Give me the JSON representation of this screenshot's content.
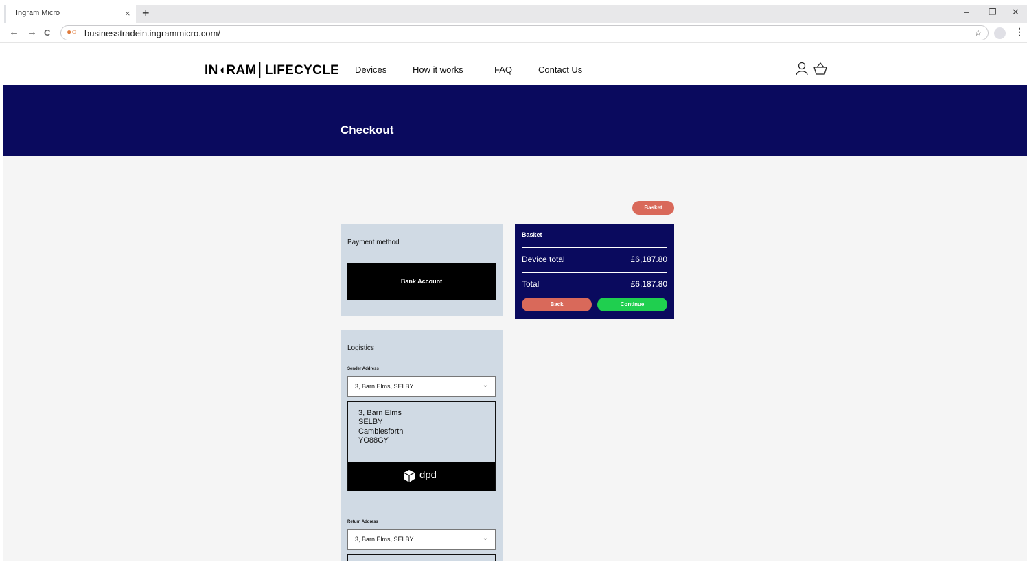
{
  "browser": {
    "tab_title": "Ingram Micro",
    "tab_close": "×",
    "new_tab": "+",
    "url": "businesstradein.ingrammicro.com/",
    "window_controls": [
      "–",
      "❐",
      "✕"
    ],
    "back": "←",
    "forward": "→",
    "reload": "C",
    "star": "☆",
    "menu": "⋮"
  },
  "header": {
    "logo": "IN◖RAM│LIFECYCLE",
    "nav": [
      "Devices",
      "How it works",
      "FAQ",
      "Contact Us"
    ],
    "icons": [
      "user-icon",
      "basket-icon"
    ]
  },
  "hero": {
    "title": "Checkout"
  },
  "basket_pill": "Basket",
  "payment": {
    "heading": "Payment method",
    "option": "Bank Account"
  },
  "summary": {
    "title": "Basket",
    "device_total_label": "Device total",
    "device_total_value": "£6,187.80",
    "total_label": "Total",
    "total_value": "£6,187.80",
    "back": "Back",
    "continue": "Continue"
  },
  "logistics": {
    "heading": "Logistics",
    "sender_label": "Sender Address",
    "sender_value": "3, Barn Elms, SELBY",
    "sender_address": [
      "3, Barn Elms",
      "SELBY",
      "Camblesforth",
      "YO88GY"
    ],
    "carrier": "dpd",
    "return_label": "Return Address",
    "return_value": "3, Barn Elms, SELBY",
    "chevron": "⌄"
  },
  "colors": {
    "navy": "#0a0a5e",
    "panel": "#d0dae4",
    "back_red": "#d9695a",
    "continue_green": "#1fcf4f"
  }
}
